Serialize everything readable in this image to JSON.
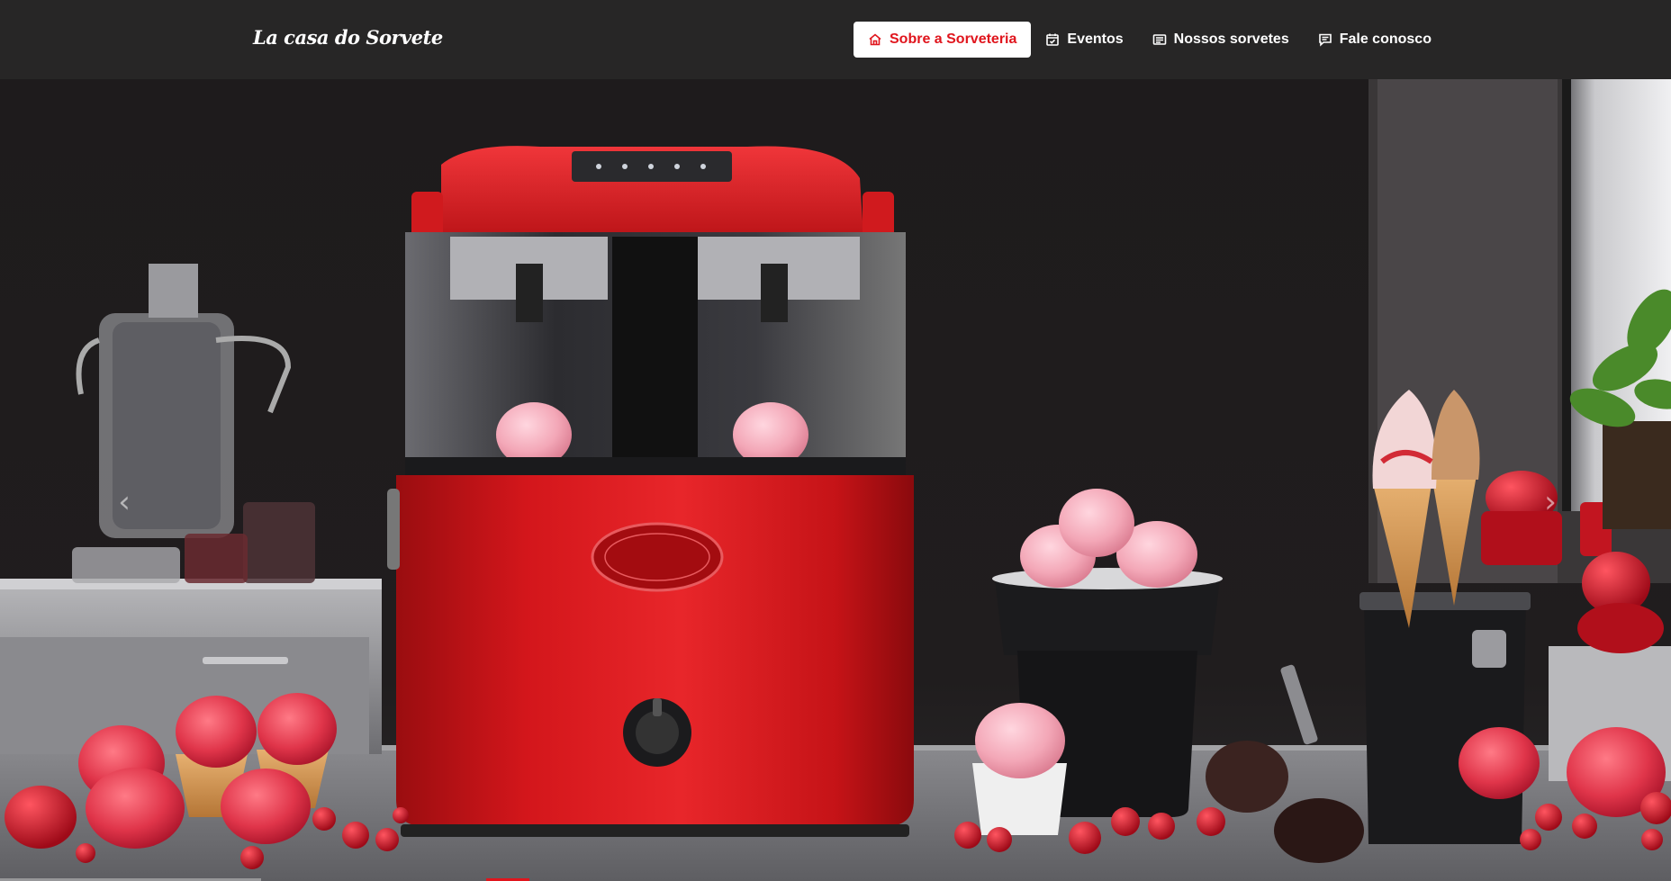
{
  "brand": {
    "name": "La casa do Sorvete"
  },
  "nav": {
    "items": [
      {
        "label": "Sobre a Sorveteria",
        "icon": "house-icon",
        "active": true
      },
      {
        "label": "Eventos",
        "icon": "calendar-icon",
        "active": false
      },
      {
        "label": "Nossos sorvetes",
        "icon": "list-card-icon",
        "active": false
      },
      {
        "label": "Fale conosco",
        "icon": "chat-icon",
        "active": false
      }
    ]
  },
  "carousel": {
    "prev_icon": "chevron-left-icon",
    "next_icon": "chevron-right-icon",
    "prev_glyph": "‹",
    "next_glyph": "›",
    "slide_count": 3,
    "active_slide": 1
  },
  "colors": {
    "navbar_bg": "#272626",
    "accent_red": "#e0151d",
    "machine_red": "#d3161b",
    "ice_cream_pink": "#f3a7b7"
  }
}
